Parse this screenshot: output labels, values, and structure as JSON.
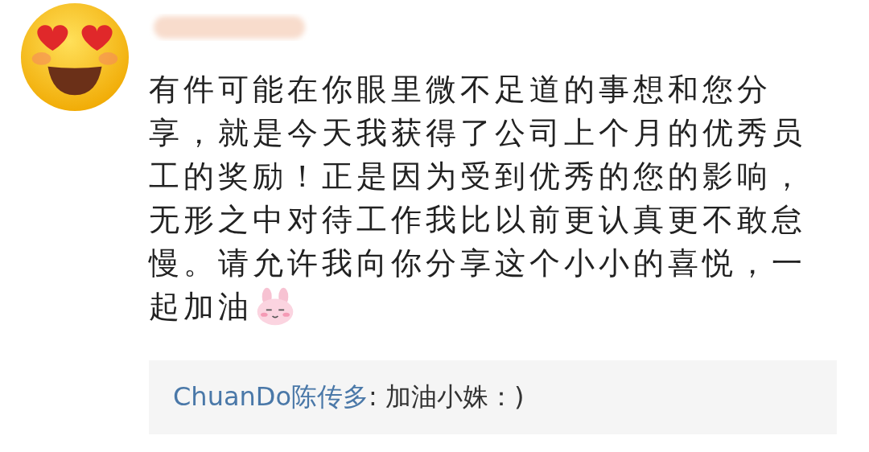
{
  "comment": {
    "lines": [
      "有件可能在你眼里微不足道的事想和您分",
      "享，就是今天我获得了公司上个月的优秀员",
      "工的奖励！正是因为受到优秀的您的影响，",
      "无形之中对待工作我比以前更认真更不敢怠",
      "慢。请允许我向你分享这个小小的喜悦，一",
      "起加油"
    ]
  },
  "reply": {
    "author": "ChuanDo陈传多",
    "text": ": 加油小姝：)"
  }
}
